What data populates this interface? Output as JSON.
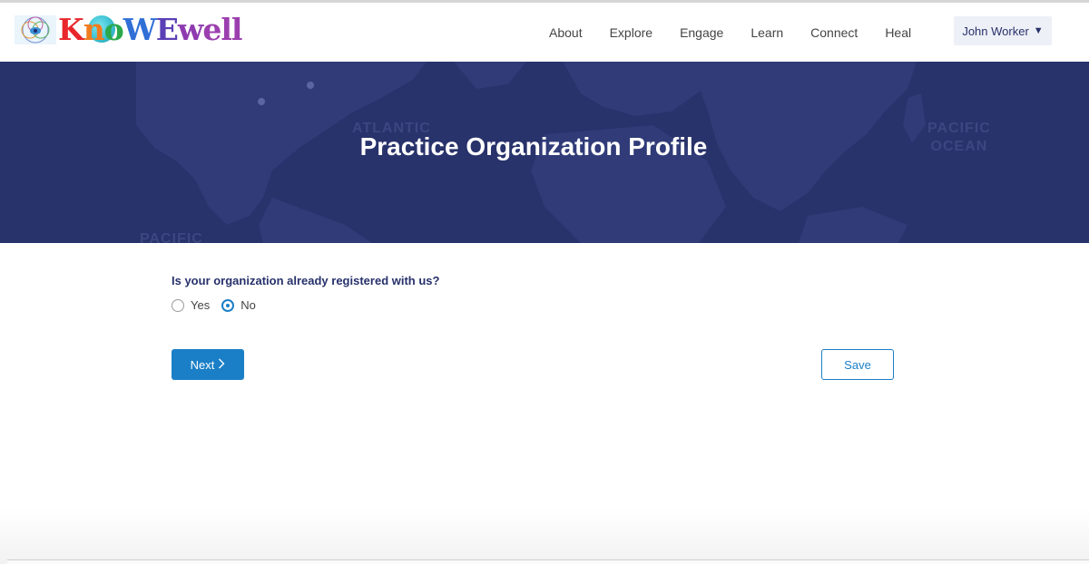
{
  "brand": {
    "letters": [
      {
        "ch": "K",
        "color": "#e8262b"
      },
      {
        "ch": "n",
        "color": "#f07c1f"
      },
      {
        "ch": "o",
        "color": "#2aa84a"
      },
      {
        "ch": "W",
        "color": "#2f6fd6"
      },
      {
        "ch": "E",
        "color": "#5b3fb5"
      },
      {
        "ch": "w",
        "color": "#8e3bb0"
      },
      {
        "ch": "e",
        "color": "#9b3fae"
      },
      {
        "ch": "l",
        "color": "#9b3fae"
      },
      {
        "ch": "l",
        "color": "#9b3fae"
      }
    ]
  },
  "nav": {
    "items": [
      "About",
      "Explore",
      "Engage",
      "Learn",
      "Connect",
      "Heal"
    ],
    "user_name": "John Worker",
    "caret": "▼"
  },
  "hero": {
    "title": "Practice Organization Profile",
    "map_labels": [
      "ATLANTIC",
      "PACIFIC\nOCEAN",
      "PACIFIC"
    ]
  },
  "form": {
    "question": "Is your organization already registered with us?",
    "options": [
      {
        "label": "Yes",
        "selected": false
      },
      {
        "label": "No",
        "selected": true
      }
    ]
  },
  "actions": {
    "next_label": "Next",
    "next_icon": "chevron-right-icon",
    "save_label": "Save"
  },
  "colors": {
    "accent": "#1a7fc7",
    "hero_bg": "#28326b",
    "heading": "#27316b"
  }
}
